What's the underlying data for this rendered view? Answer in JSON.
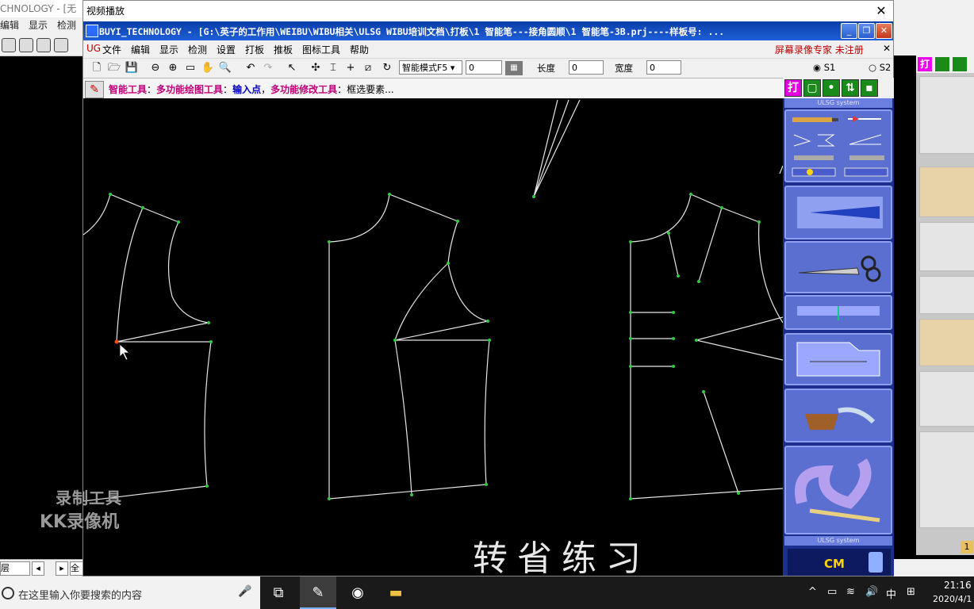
{
  "background_left_window": {
    "title": "CHNOLOGY - [无",
    "menu": [
      "编辑",
      "显示",
      "检测"
    ],
    "status_left": "层",
    "status_right": "全"
  },
  "player": {
    "title": "视频播放",
    "close_label": "✕"
  },
  "app": {
    "title": "BUYI_TECHNOLOGY - [G:\\英子的工作用\\WEIBU\\WIBU相关\\ULSG WIBU培训文档\\打板\\1 智能笔---接角圆顺\\1 智能笔-3B.prj----样板号: ...",
    "menu": {
      "ug": "UG",
      "items": [
        "文件",
        "编辑",
        "显示",
        "检测",
        "设置",
        "打板",
        "推板",
        "图标工具",
        "帮助"
      ],
      "right_text": "屏幕录像专家  未注册"
    },
    "toolbar": {
      "mode_value": "智能模式F5",
      "field1_value": "0",
      "length_label": "长度",
      "length_value": "0",
      "width_label": "宽度",
      "width_value": "0",
      "s1_label": "S1",
      "s2_label": "S2"
    },
    "hint": {
      "tool": "智能工具",
      "part1": "多功能绘图工具",
      "part2": "输入点",
      "part3": "多功能修改工具",
      "part4": "框选要素..."
    },
    "tool_panel": {
      "top_button": "打",
      "strip_top": "ULSG system",
      "strip_bottom": "ULSG system",
      "cm_label": "CM"
    }
  },
  "overlay": {
    "watermark_line1": "录制工具",
    "watermark_line2": "KK录像机",
    "caption": "转省练习"
  },
  "taskbar": {
    "search_placeholder": "在这里输入你要搜索的内容",
    "ime": "中",
    "time": "21:16",
    "date": "2020/4/1"
  },
  "background_right": {
    "top_button": "打",
    "status": "1"
  },
  "colors": {
    "title_blue": "#1f5fd8",
    "panel_blue": "#1c2f8f",
    "node_green": "#2ecc40",
    "pattern_line": "#e6e6e6",
    "hint_magenta": "#c0007a"
  }
}
